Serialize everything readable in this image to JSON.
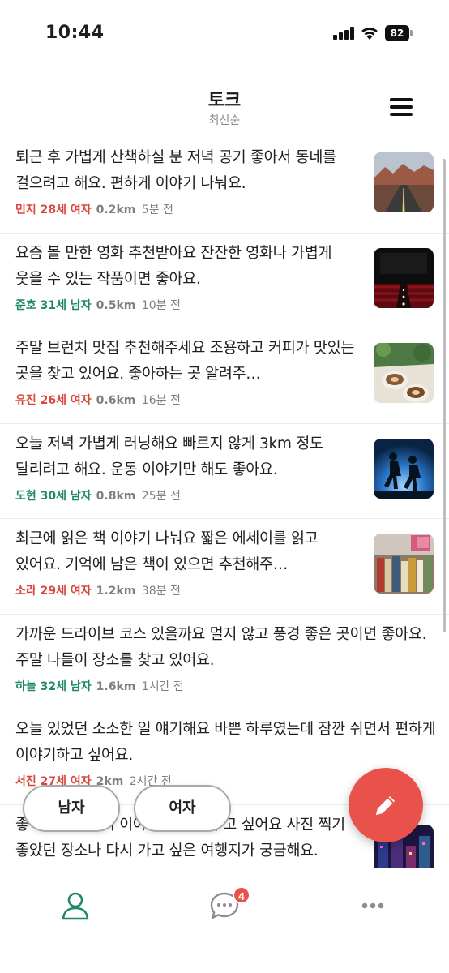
{
  "status_bar": {
    "time": "10:44",
    "battery": "82"
  },
  "header": {
    "title": "토크",
    "subtitle": "최신순"
  },
  "posts": [
    {
      "text": "퇴근 후 가볍게 산책하실 분 저녁 공기 좋아서 동네를 걸으려고 해요. 편하게 이야기 나눠요.",
      "user": "민지 28세 여자",
      "distance": "0.2km",
      "time": "5분 전",
      "gender_color": "#d9463b",
      "thumbnail": "desert-road"
    },
    {
      "text": "요즘 볼 만한 영화 추천받아요 잔잔한 영화나 가볍게 웃을 수 있는 작품이면 좋아요.",
      "user": "준호 31세 남자",
      "distance": "0.5km",
      "time": "10분 전",
      "gender_color": "#1f8a5f",
      "thumbnail": "cinema"
    },
    {
      "text": "주말 브런치 맛집 추천해주세요 조용하고 커피가 맛있는 곳을 찾고 있어요. 좋아하는 곳 알려주…",
      "user": "유진 26세 여자",
      "distance": "0.6km",
      "time": "16분 전",
      "gender_color": "#d9463b",
      "thumbnail": "coffee"
    },
    {
      "text": "오늘 저녁 가볍게 러닝해요 빠르지 않게 3km 정도 달리려고 해요. 운동 이야기만 해도 좋아요.",
      "user": "도현 30세 남자",
      "distance": "0.8km",
      "time": "25분 전",
      "gender_color": "#1f8a5f",
      "thumbnail": "runners"
    },
    {
      "text": "최근에 읽은 책 이야기 나눠요 짧은 에세이를 읽고 있어요. 기억에 남은 책이 있으면 추천해주…",
      "user": "소라 29세 여자",
      "distance": "1.2km",
      "time": "38분 전",
      "gender_color": "#d9463b",
      "thumbnail": "books"
    },
    {
      "text": "가까운 드라이브 코스 있을까요 멀지 않고 풍경 좋은 곳이면 좋아요. 주말 나들이 장소를 찾고 있어요.",
      "user": "하늘 32세 남자",
      "distance": "1.6km",
      "time": "1시간 전",
      "gender_color": "#1f8a5f",
      "thumbnail": ""
    },
    {
      "text": "오늘 있었던 소소한 일 얘기해요 바쁜 하루였는데 잠깐 쉬면서 편하게 이야기하고 싶어요.",
      "user": "서진 27세 여자",
      "distance": "2km",
      "time": "2시간 전",
      "gender_color": "#d9463b",
      "thumbnail": ""
    },
    {
      "text": "좋아하는 여행지 이야기 하며 나누고 싶어요 사진 찍기 좋았던 장소나 다시 가고 싶은 여행지가 궁금해요.",
      "user": "",
      "distance": "",
      "time": "",
      "gender_color": "#1f8a5f",
      "thumbnail": "city-night"
    }
  ],
  "filters": {
    "male": "남자",
    "female": "여자"
  },
  "fab": {
    "icon": "pencil-icon",
    "color": "#e9524a"
  },
  "bottom_nav": {
    "items": [
      {
        "icon": "person-icon",
        "active": true
      },
      {
        "icon": "chat-bubble-icon",
        "badge": "4"
      },
      {
        "icon": "more-dots-icon"
      }
    ]
  },
  "colors": {
    "accent": "#e9524a",
    "male": "#1f8a5f",
    "female": "#d9463b",
    "active_nav": "#1f8a5f"
  }
}
